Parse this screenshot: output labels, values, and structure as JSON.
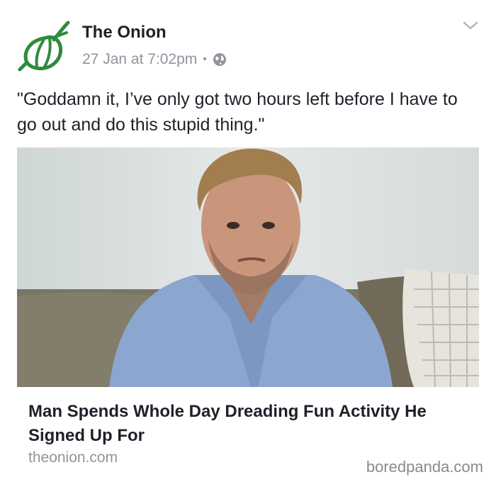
{
  "post": {
    "page_name": "The Onion",
    "date": "27 Jan at 7:02pm",
    "separator": "•",
    "privacy_icon": "globe-icon",
    "menu_icon": "chevron-down-icon",
    "avatar_icon": "onion-logo",
    "caption": "\"Goddamn it, I’ve only got two hours left before I have to go out and do this stupid thing.\""
  },
  "link": {
    "title": "Man Spends Whole Day Dreading Fun Activity He Signed Up For",
    "domain": "theonion.com"
  },
  "watermark": "boredpanda.com",
  "colors": {
    "brand_green": "#2e8b3c",
    "meta_gray": "#90949c",
    "text": "#1d2129"
  }
}
